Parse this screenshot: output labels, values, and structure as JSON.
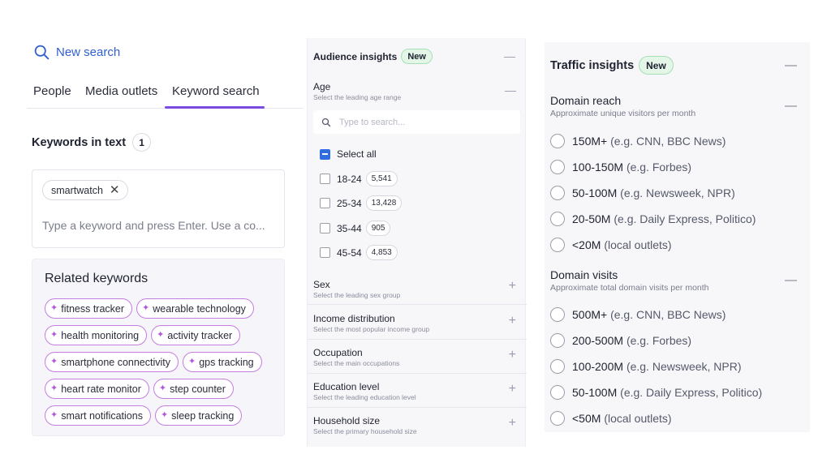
{
  "left": {
    "new_search": "New search",
    "tabs": [
      "People",
      "Media outlets",
      "Keyword search"
    ],
    "keywords_title": "Keywords in text",
    "keywords_count": "1",
    "chip": "smartwatch",
    "chip_remove": "✕",
    "input_placeholder": "Type a keyword and press Enter. Use a co...",
    "related_title": "Related keywords",
    "related_rows": [
      [
        "fitness tracker",
        "wearable technology"
      ],
      [
        "health monitoring",
        "activity tracker"
      ],
      [
        "smartphone connectivity",
        "gps tracking"
      ],
      [
        "heart rate monitor",
        "step counter"
      ],
      [
        "smart notifications",
        "sleep tracking"
      ]
    ]
  },
  "audience": {
    "title": "Audience insights",
    "new_badge": "New",
    "collapse": "—",
    "age": {
      "title": "Age",
      "subtitle": "Select the leading age range",
      "control": "—",
      "search_placeholder": "Type to search...",
      "select_all": "Select all",
      "options": [
        {
          "label": "18-24",
          "count": "5,541"
        },
        {
          "label": "25-34",
          "count": "13,428"
        },
        {
          "label": "35-44",
          "count": "905"
        },
        {
          "label": "45-54",
          "count": "4,853"
        }
      ]
    },
    "sections": [
      {
        "title": "Sex",
        "subtitle": "Select the leading sex group",
        "control": "+"
      },
      {
        "title": "Income distribution",
        "subtitle": "Select the most popular income group",
        "control": "+"
      },
      {
        "title": "Occupation",
        "subtitle": "Select the main occupations",
        "control": "+"
      },
      {
        "title": "Education level",
        "subtitle": "Select the leading education level",
        "control": "+"
      },
      {
        "title": "Household size",
        "subtitle": "Select the primary household size",
        "control": "+"
      }
    ]
  },
  "traffic": {
    "title": "Traffic insights",
    "new_badge": "New",
    "collapse": "—",
    "reach": {
      "title": "Domain reach",
      "subtitle": "Approximate unique visitors per month",
      "control": "—",
      "options": [
        {
          "main": "150M+",
          "eg": "(e.g. CNN, BBC News)"
        },
        {
          "main": "100-150M",
          "eg": "(e.g. Forbes)"
        },
        {
          "main": "50-100M",
          "eg": "(e.g. Newsweek, NPR)"
        },
        {
          "main": "20-50M",
          "eg": "(e.g. Daily Express, Politico)"
        },
        {
          "main": "<20M",
          "eg": "(local outlets)"
        }
      ]
    },
    "visits": {
      "title": "Domain visits",
      "subtitle": "Approximate total domain visits per month",
      "control": "—",
      "options": [
        {
          "main": "500M+",
          "eg": "(e.g. CNN, BBC News)"
        },
        {
          "main": "200-500M",
          "eg": "(e.g. Forbes)"
        },
        {
          "main": "100-200M",
          "eg": "(e.g. Newsweek, NPR)"
        },
        {
          "main": "50-100M",
          "eg": "(e.g. Daily Express, Politico)"
        },
        {
          "main": "<50M",
          "eg": "(local outlets)"
        }
      ]
    }
  }
}
